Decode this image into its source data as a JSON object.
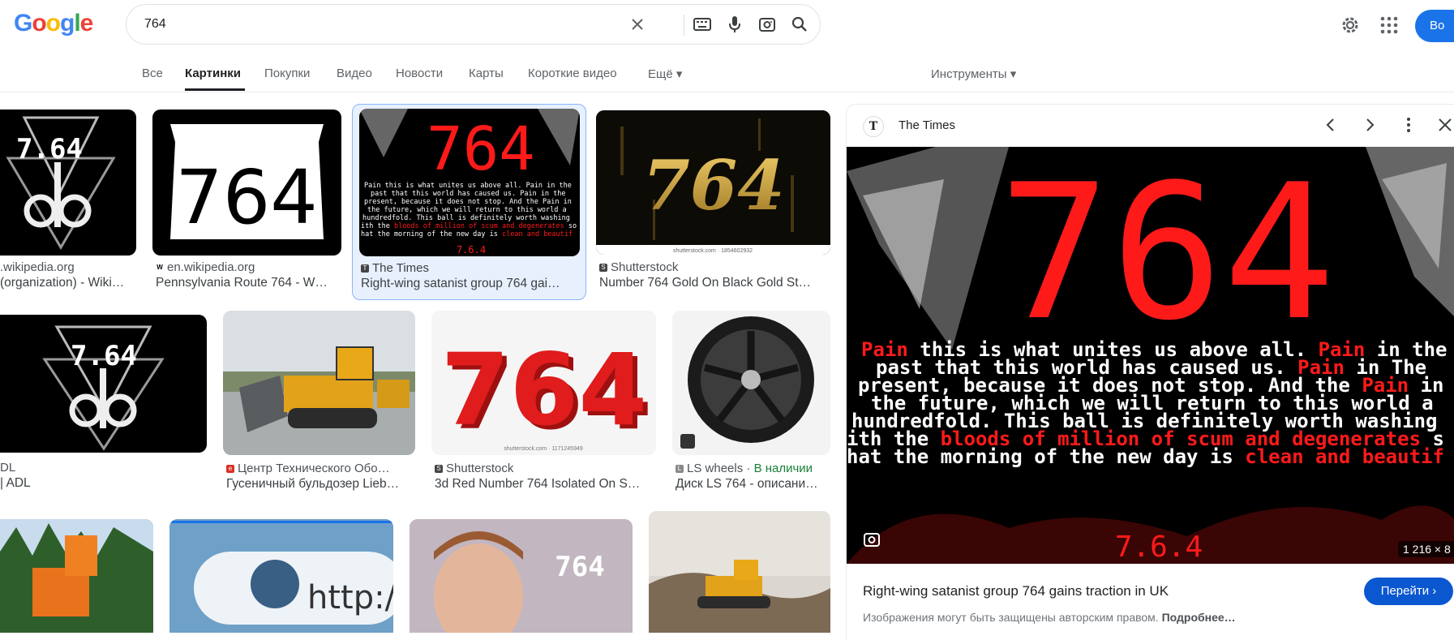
{
  "header": {
    "logo_letters": [
      "G",
      "o",
      "o",
      "g",
      "l",
      "e"
    ],
    "logo_colors": [
      "#4285f4",
      "#ea4335",
      "#fbbc05",
      "#4285f4",
      "#34a853",
      "#ea4335"
    ],
    "search_value": "764",
    "signin_label": "Во"
  },
  "tabs": [
    {
      "label": "Все"
    },
    {
      "label": "Картинки"
    },
    {
      "label": "Покупки"
    },
    {
      "label": "Видео"
    },
    {
      "label": "Новости"
    },
    {
      "label": "Карты"
    },
    {
      "label": "Короткие видео"
    },
    {
      "label": "Ещё ▾"
    }
  ],
  "tools_label": "Инструменты ▾",
  "results": [
    {
      "source": ".wikipedia.org",
      "title": " (organization) - Wiki…",
      "thumb_text": "7.64"
    },
    {
      "source": "en.wikipedia.org",
      "title": "Pennsylvania Route 764 - W…",
      "thumb_text": "764"
    },
    {
      "source": "The Times",
      "title": "Right-wing satanist group 764 gai…",
      "thumb_text": "764"
    },
    {
      "source": "Shutterstock",
      "title": "Number 764 Gold On Black Gold St…",
      "thumb_text": "764",
      "watermark": "shutterstock.com · 1854602932"
    },
    {
      "source": "DL",
      "title": "| ADL",
      "thumb_text": "7.64"
    },
    {
      "source": "Центр Технического Обо…",
      "title": "Гусеничный бульдозер Lieb…"
    },
    {
      "source": "Shutterstock",
      "title": "3d Red Number 764 Isolated On S…",
      "thumb_text": "764",
      "watermark": "shutterstock.com · 1171245949"
    },
    {
      "source": "LS wheels",
      "availability": "В наличии",
      "title": "Диск LS 764 - описани…"
    }
  ],
  "row3_thumb_text": "http://w",
  "panel": {
    "source": "The Times",
    "title": "Right-wing satanist group 764 gains traction in UK",
    "goto_label": "Перейти ›",
    "copyright": "Изображения могут быть защищены авторским правом.",
    "more_link": "Подробнее…",
    "dimensions": "1 216 × 8",
    "image_big": "764",
    "image_lines": [
      [
        "Pain",
        " this is what unites us above all. ",
        "Pain",
        " in the"
      ],
      [
        "past that this world has caused us. ",
        "Pain",
        " in The"
      ],
      [
        "present, because it does not stop. And the ",
        "Pain",
        " in"
      ],
      [
        "the future, which we will return to this world a"
      ],
      [
        "hundredfold. This ball is definitely worth washing"
      ],
      [
        "ith the ",
        "bloods of million of scum and degenerates",
        " s"
      ],
      [
        "hat the morning of the new day is ",
        "clean and beautif"
      ]
    ],
    "image_footer": "7.6.4"
  }
}
